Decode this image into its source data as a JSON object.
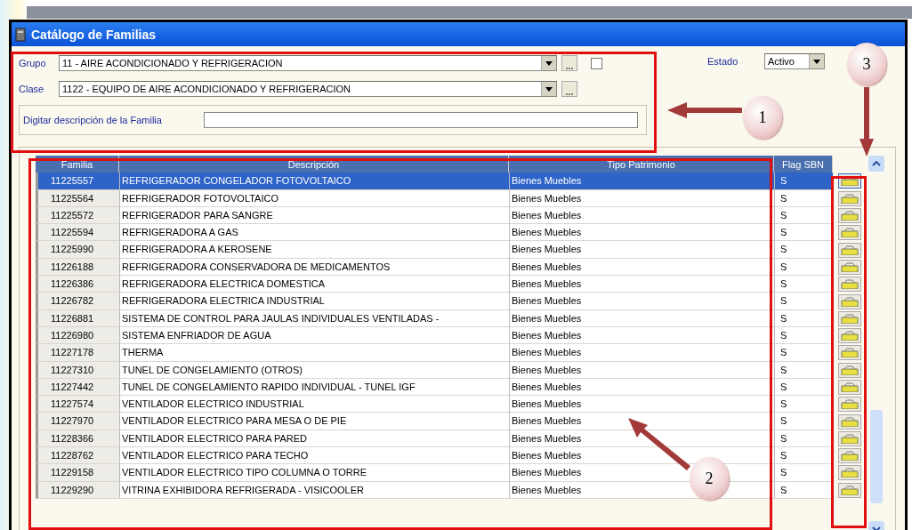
{
  "window": {
    "title": "Catálogo de Familias"
  },
  "filters": {
    "grupo": {
      "label": "Grupo",
      "value": "11 - AIRE ACONDICIONADO Y REFRIGERACION"
    },
    "clase": {
      "label": "Clase",
      "value": "1122 - EQUIPO DE AIRE ACONDICIONADO Y REFRIGERACION"
    },
    "checkbox": {
      "checked": false
    },
    "description": {
      "label": "Digitar descripción de la Familia"
    },
    "estado": {
      "label": "Estado",
      "value": "Activo"
    }
  },
  "table": {
    "columns": [
      "Familia",
      "Descripción",
      "Tipo Patrimonio",
      "Flag SBN"
    ],
    "rows": [
      {
        "familia": "11225557",
        "descripcion": "REFRIGERADOR CONGELADOR FOTOVOLTAICO",
        "tipo": "Bienes Muebles",
        "flag": "S",
        "selected": true
      },
      {
        "familia": "11225564",
        "descripcion": "REFRIGERADOR FOTOVOLTAICO",
        "tipo": "Bienes Muebles",
        "flag": "S",
        "selected": false
      },
      {
        "familia": "11225572",
        "descripcion": "REFRIGERADOR PARA SANGRE",
        "tipo": "Bienes Muebles",
        "flag": "S",
        "selected": false
      },
      {
        "familia": "11225594",
        "descripcion": "REFRIGERADORA A GAS",
        "tipo": "Bienes Muebles",
        "flag": "S",
        "selected": false
      },
      {
        "familia": "11225990",
        "descripcion": "REFRIGERADORA A KEROSENE",
        "tipo": "Bienes Muebles",
        "flag": "S",
        "selected": false
      },
      {
        "familia": "11226188",
        "descripcion": "REFRIGERADORA CONSERVADORA DE MEDICAMENTOS",
        "tipo": "Bienes Muebles",
        "flag": "S",
        "selected": false
      },
      {
        "familia": "11226386",
        "descripcion": "REFRIGERADORA ELECTRICA DOMESTICA",
        "tipo": "Bienes Muebles",
        "flag": "S",
        "selected": false
      },
      {
        "familia": "11226782",
        "descripcion": "REFRIGERADORA ELECTRICA INDUSTRIAL",
        "tipo": "Bienes Muebles",
        "flag": "S",
        "selected": false
      },
      {
        "familia": "11226881",
        "descripcion": "SISTEMA DE CONTROL PARA JAULAS INDIVIDUALES VENTILADAS -",
        "tipo": "Bienes Muebles",
        "flag": "S",
        "selected": false
      },
      {
        "familia": "11226980",
        "descripcion": "SISTEMA ENFRIADOR DE AGUA",
        "tipo": "Bienes Muebles",
        "flag": "S",
        "selected": false
      },
      {
        "familia": "11227178",
        "descripcion": "THERMA",
        "tipo": "Bienes Muebles",
        "flag": "S",
        "selected": false
      },
      {
        "familia": "11227310",
        "descripcion": "TUNEL DE CONGELAMIENTO (OTROS)",
        "tipo": "Bienes Muebles",
        "flag": "S",
        "selected": false
      },
      {
        "familia": "11227442",
        "descripcion": "TUNEL DE CONGELAMIENTO RAPIDO INDIVIDUAL - TUNEL IGF",
        "tipo": "Bienes Muebles",
        "flag": "S",
        "selected": false
      },
      {
        "familia": "11227574",
        "descripcion": "VENTILADOR ELECTRICO INDUSTRIAL",
        "tipo": "Bienes Muebles",
        "flag": "S",
        "selected": false
      },
      {
        "familia": "11227970",
        "descripcion": "VENTILADOR ELECTRICO PARA MESA O DE PIE",
        "tipo": "Bienes Muebles",
        "flag": "S",
        "selected": false
      },
      {
        "familia": "11228366",
        "descripcion": "VENTILADOR ELECTRICO PARA PARED",
        "tipo": "Bienes Muebles",
        "flag": "S",
        "selected": false
      },
      {
        "familia": "11228762",
        "descripcion": "VENTILADOR ELECTRICO PARA TECHO",
        "tipo": "Bienes Muebles",
        "flag": "S",
        "selected": false
      },
      {
        "familia": "11229158",
        "descripcion": "VENTILADOR ELECTRICO TIPO COLUMNA O TORRE",
        "tipo": "Bienes Muebles",
        "flag": "S",
        "selected": false
      },
      {
        "familia": "11229290",
        "descripcion": "VITRINA EXHIBIDORA REFRIGERADA - VISICOOLER",
        "tipo": "Bienes Muebles",
        "flag": "S",
        "selected": false
      }
    ]
  },
  "annotations": [
    {
      "number": "1"
    },
    {
      "number": "2"
    },
    {
      "number": "3"
    }
  ]
}
